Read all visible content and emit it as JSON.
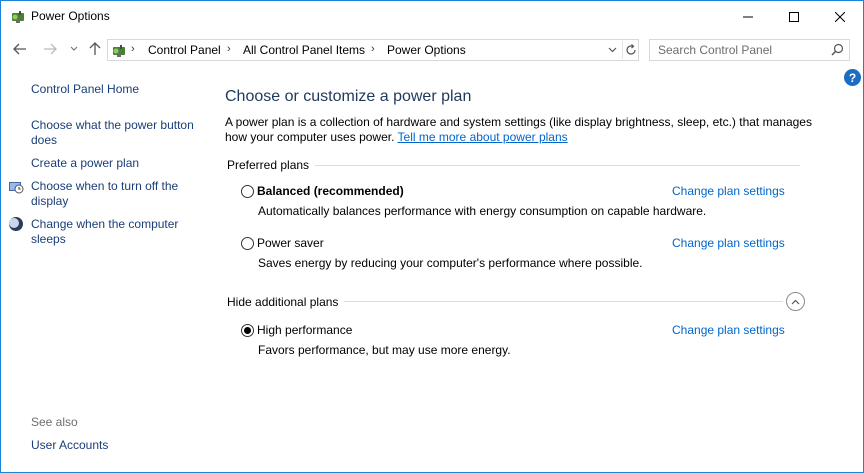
{
  "window": {
    "title": "Power Options"
  },
  "address": {
    "crumbs": [
      "Control Panel",
      "All Control Panel Items",
      "Power Options"
    ],
    "search_placeholder": "Search Control Panel"
  },
  "sidebar": {
    "home": "Control Panel Home",
    "links": [
      "Choose what the power button does",
      "Create a power plan",
      "Choose when to turn off the display",
      "Change when the computer sleeps"
    ],
    "see_also_label": "See also",
    "see_also_links": [
      "User Accounts"
    ]
  },
  "main": {
    "title": "Choose or customize a power plan",
    "intro_text": "A power plan is a collection of hardware and system settings (like display brightness, sleep, etc.) that manages how your computer uses power.",
    "intro_link": "Tell me more about power plans",
    "preferred_label": "Preferred plans",
    "additional_label": "Hide additional plans",
    "change_label": "Change plan settings",
    "plans": [
      {
        "name": "Balanced (recommended)",
        "desc": "Automatically balances performance with energy consumption on capable hardware.",
        "selected": false
      },
      {
        "name": "Power saver",
        "desc": "Saves energy by reducing your computer's performance where possible.",
        "selected": false
      },
      {
        "name": "High performance",
        "desc": "Favors performance, but may use more energy.",
        "selected": true
      }
    ]
  },
  "colors": {
    "link": "#1a3e78",
    "accent_link": "#0066cc",
    "title": "#1e395b",
    "border": "#1883d7"
  },
  "icons": {
    "app": "power-options-icon",
    "help": "help-icon"
  }
}
